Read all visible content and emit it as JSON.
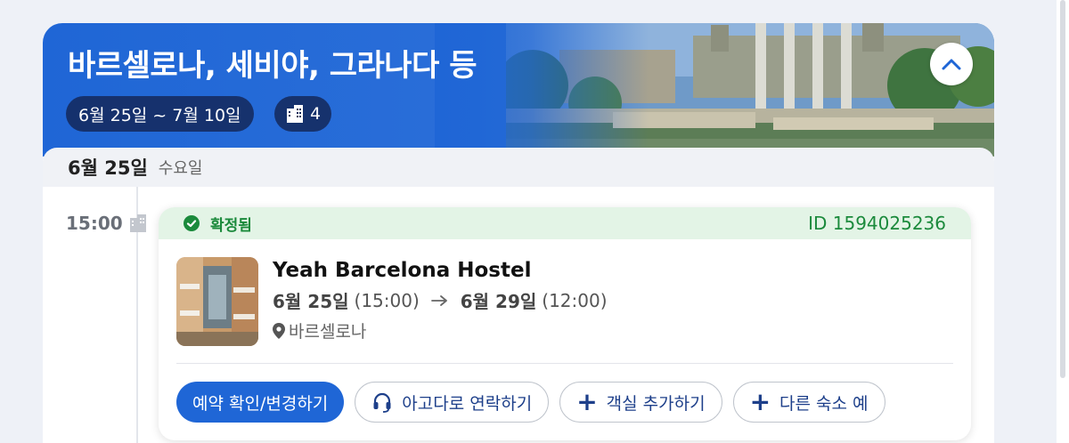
{
  "trip": {
    "title": "바르셀로나, 세비야, 그라나다 등",
    "dates": "6월 25일 ~ 7월 10일",
    "hotel_count": "4"
  },
  "day": {
    "date": "6월 25일",
    "weekday": "수요일"
  },
  "event": {
    "time": "15:00"
  },
  "booking": {
    "status": "확정됨",
    "id": "ID 1594025236",
    "hotel_name": "Yeah Barcelona Hostel",
    "checkin_date": "6월 25일",
    "checkin_time": "(15:00)",
    "checkout_date": "6월 29일",
    "checkout_time": "(12:00)",
    "location": "바르셀로나"
  },
  "actions": {
    "manage": "예약 확인/변경하기",
    "contact": "아고다로 연락하기",
    "add_room": "객실 추가하기",
    "other_stay": "다른 숙소 예"
  },
  "colors": {
    "brand_blue": "#1f66d6",
    "success_green": "#1b8a3c",
    "success_bg": "#e3f4e6"
  },
  "icons": {
    "collapse": "chevron-up-icon",
    "hotel": "building-icon",
    "status": "check-circle-icon",
    "location": "map-pin-icon",
    "support": "headset-icon",
    "arrow": "arrow-right-icon",
    "add": "plus-icon"
  }
}
